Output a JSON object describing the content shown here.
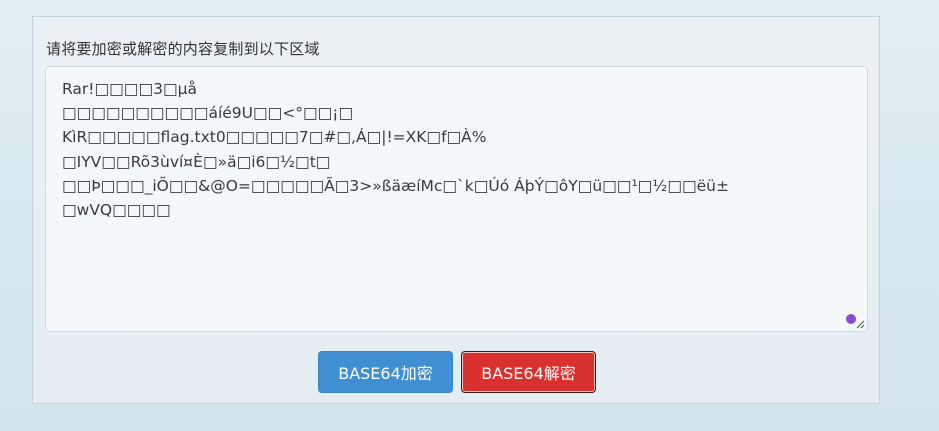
{
  "panel": {
    "label": "请将要加密或解密的内容复制到以下区域"
  },
  "textarea": {
    "lines": [
      "Rar!□□□□3□µå",
      "□□□□□□□□□□áíé9U□□<°□□¡□",
      "KìR□□□□□flag.txt0□□□□□7□#□,Á□|!=XK□f□À%",
      "□IYV□□Rõ3ùví¤È□»ä□i6□½□t□",
      "□□Þ□□□_iÕ□□&@O=□□□□□Ã□3>»ßäæíMc□`k□Úó ÁþÝ□ôY□ü□□¹□½□□ëü±",
      "□wVQ□□□□"
    ]
  },
  "buttons": {
    "encode_label": "BASE64加密",
    "decode_label": "BASE64解密"
  },
  "colors": {
    "encode_button": "#3f8fd2",
    "decode_button": "#d9312e",
    "grammar_dot": "#8a4bd8"
  },
  "icons": {
    "grammar_indicator": "grammar-check-dot-icon",
    "resize": "resize-handle-icon"
  }
}
